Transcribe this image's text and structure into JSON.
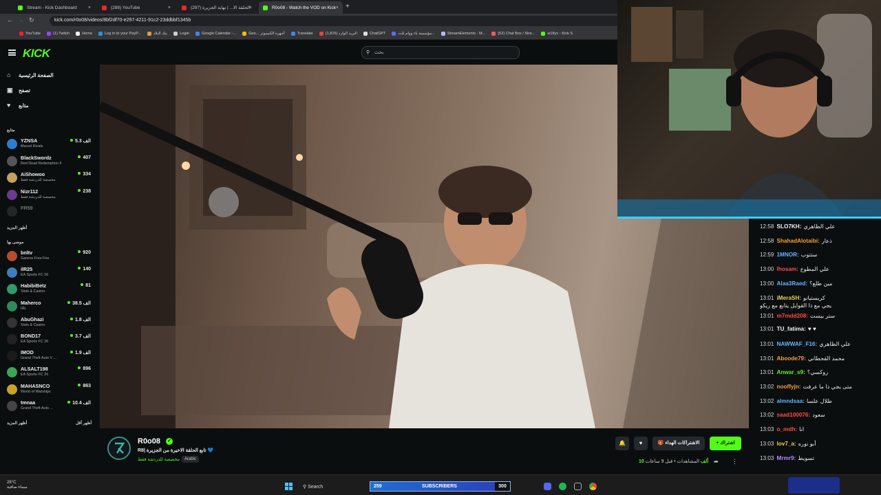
{
  "browser": {
    "tabs": [
      {
        "label": "Stream - Kick Dashboard",
        "color": "#53fc18",
        "active": false
      },
      {
        "label": "(288) YouTube",
        "color": "#ff2020",
        "active": false
      },
      {
        "label": "(287) الحلقة الا... | نهاية الجزيرة",
        "color": "#ff2020",
        "active": false
      },
      {
        "label": "R0o08 - Watch the VOD on Kick",
        "color": "#53fc18",
        "active": true
      }
    ],
    "url": "kick.com/r0o08/videos/8bf2df70-e297-4211-91c2-23ddbbf1345b",
    "bookmarks": [
      {
        "label": "YouTube",
        "color": "#ff2020"
      },
      {
        "label": "(1) Twitch",
        "color": "#9146ff"
      },
      {
        "label": "Home",
        "color": "#eeeeee"
      },
      {
        "label": "Log in to your PayP...",
        "color": "#1a9bd7"
      },
      {
        "label": "بنك البلاد",
        "color": "#d9a23a"
      },
      {
        "label": "Login",
        "color": "#cccccc"
      },
      {
        "label": "Google Calendar -...",
        "color": "#4285f4"
      },
      {
        "label": "Goo... أجهزة الكمبيوتر",
        "color": "#fbbc05"
      },
      {
        "label": "Translate",
        "color": "#4285f4"
      },
      {
        "label": "البريد الوارد (1,815)",
        "color": "#ea4335"
      },
      {
        "label": "ChatGPT",
        "color": "#dddddd"
      },
      {
        "label": "مؤسسة باء ووام للت...",
        "color": "#5b6bff"
      },
      {
        "label": "StreamElements - M...",
        "color": "#b9b9ff"
      },
      {
        "label": "(52) Chat Box / Stre...",
        "color": "#ff5a5a"
      },
      {
        "label": "w18yv - Kick S",
        "color": "#53fc18"
      }
    ]
  },
  "header": {
    "logo": "KICK",
    "search_placeholder": "بحث"
  },
  "sidebar": {
    "nav": [
      {
        "label": "الصفحة الرئيسية",
        "icon": "home-icon",
        "glyph": "⌂"
      },
      {
        "label": "تصفح",
        "icon": "browse-icon",
        "glyph": "▣"
      },
      {
        "label": "متابع",
        "icon": "heart-icon",
        "glyph": "♥"
      }
    ],
    "following_label": "متابع",
    "following": [
      {
        "name": "YZNSA",
        "category": "Marvel Rivals",
        "viewers": "الف 5.3",
        "color": "#2d7dd2"
      },
      {
        "name": "BlackSwordz",
        "category": "Red Dead Redemption II",
        "viewers": "407",
        "color": "#555555"
      },
      {
        "name": "AiShowoo",
        "category": "مخصصة للدردشة فقط",
        "viewers": "334",
        "color": "#c2a25e"
      },
      {
        "name": "Nizr112",
        "category": "مخصصة للدردشة فقط",
        "viewers": "238",
        "color": "#6a3c8c"
      },
      {
        "name": "FR59",
        "category": "",
        "viewers": "",
        "color": "#444444"
      }
    ],
    "show_more": "أظهر المزيد",
    "recommended_label": "موصى بها",
    "recommended": [
      {
        "name": "bnltv",
        "category": "Garena Free Fire",
        "viewers": "920",
        "color": "#b74b2e"
      },
      {
        "name": "ilR25",
        "category": "EA Sports FC 26",
        "viewers": "140",
        "color": "#3b7fb8"
      },
      {
        "name": "HabibiBetz",
        "category": "Slots & Casino",
        "viewers": "81",
        "color": "#2d9c6a"
      },
      {
        "name": "Maherco",
        "category": "IRL",
        "viewers": "الف 38.5",
        "color": "#2e8b57"
      },
      {
        "name": "AbuGhazi",
        "category": "Slots & Casino",
        "viewers": "الف 1.8",
        "color": "#333333"
      },
      {
        "name": "BOND17",
        "category": "EA Sports FC 26",
        "viewers": "الف 3.7",
        "color": "#222222"
      },
      {
        "name": "IMOD",
        "category": "Grand Theft Auto V ...",
        "viewers": "الف 1.9",
        "color": "#1b1b1b"
      },
      {
        "name": "ALSALT198",
        "category": "EA Sports FC 26",
        "viewers": "896",
        "color": "#3aa655"
      },
      {
        "name": "MAHASNCO",
        "category": "World of Warships",
        "viewers": "863",
        "color": "#c9a227"
      },
      {
        "name": "tmnaa",
        "category": "Grand Theft Auto ...",
        "viewers": "الف 10.4",
        "color": "#444444"
      }
    ],
    "show_more_2": "أظهر المزيد",
    "show_less": "أظهر أقل"
  },
  "chat": {
    "messages": [
      {
        "time": "12:58",
        "user": "SLO7KH:",
        "ucolor": "#f2f2f2",
        "text": "علي الظاهري"
      },
      {
        "time": "12:58",
        "user": "ShahadAlotaibi:",
        "ucolor": "#f59f3a",
        "text": "ذعار"
      },
      {
        "time": "12:59",
        "user": "1MNOR:",
        "ucolor": "#66b3ff",
        "text": "ستتوب"
      },
      {
        "time": "13:00",
        "user": "lhosam:",
        "ucolor": "#ff4b4b",
        "text": "علي المطوع"
      },
      {
        "time": "13:00",
        "user": "Alaa3Raed:",
        "ucolor": "#66b3ff",
        "text": "مين طلع؟"
      },
      {
        "time": "13:01",
        "user": "iMeraSH:",
        "ucolor": "#e8d44d",
        "text": "كريستيانو"
      },
      {
        "time": "",
        "user": "",
        "ucolor": "#ffffff",
        "text": "يجي مع ذا القوايل يتابع مع ريكو"
      },
      {
        "time": "13:01",
        "user": "m7mdd208:",
        "ucolor": "#ff4b4b",
        "text": "ستر بيست"
      },
      {
        "time": "13:01",
        "user": "TU_fatima:",
        "ucolor": "#f2f2f2",
        "text": "♥ ♥"
      },
      {
        "time": "13:01",
        "user": "NAWWAF_F16:",
        "ucolor": "#66b3ff",
        "text": "علي الظاهري"
      },
      {
        "time": "13:01",
        "user": "Aboode79:",
        "ucolor": "#f59f3a",
        "text": "محمد القحطاني"
      },
      {
        "time": "13:01",
        "user": "Anwar_s9:",
        "ucolor": "#53fc18",
        "text": "روكسي؟"
      },
      {
        "time": "13:02",
        "user": "nooffyjn:",
        "ucolor": "#f59f3a",
        "text": "متى يجي ذا ما عرفت"
      },
      {
        "time": "13:02",
        "user": "almndsaa:",
        "ucolor": "#66b3ff",
        "text": "طلال علسا"
      },
      {
        "time": "13:02",
        "user": "saad100076:",
        "ucolor": "#ff4b4b",
        "text": "سعود"
      },
      {
        "time": "13:03",
        "user": "o_mdh:",
        "ucolor": "#ff4b4b",
        "text": "انا"
      },
      {
        "time": "13:03",
        "user": "lov7_a:",
        "ucolor": "#e8d44d",
        "text": "أبو نوره"
      },
      {
        "time": "13:03",
        "user": "Mrmr9:",
        "ucolor": "#b58cff",
        "text": "تسويط"
      }
    ]
  },
  "video_info": {
    "channel": "R0o08",
    "title": "R8| تابع الحلقة الاخيرة من الجزيرة 💙",
    "category": "مخصصة للدردشة فقط",
    "language": "Arabic",
    "subscribe_label": "+ اشتراك",
    "gift_label": "🎁 الاشتراكات الهداء",
    "views_label": "المشاهدات",
    "views_value": "10 ألف",
    "time_ago": "قبل 9 ساعات"
  },
  "taskbar": {
    "weather_temp": "28°C",
    "weather_desc": "سماء صافية",
    "search_label": "Search",
    "subs_count": "259",
    "subs_label": "SUBSCRIBERS",
    "subs_goal": "300"
  }
}
